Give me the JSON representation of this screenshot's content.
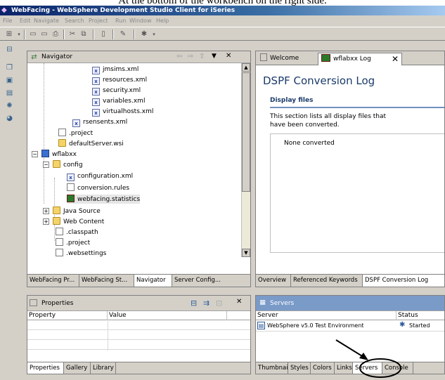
{
  "caption": "At the bottom of the workbench on the right side.",
  "window": {
    "title": "WebFacing - WebSphere Development Studio Client for iSeries"
  },
  "menu": [
    "File",
    "Edit",
    "Navigate",
    "Search",
    "Project",
    "Run",
    "Window",
    "Help"
  ],
  "navigator": {
    "title": "Navigator",
    "tree": [
      {
        "label": "jmsims.xml",
        "icon": "xml-file-icon"
      },
      {
        "label": "resources.xml",
        "icon": "xml-file-icon"
      },
      {
        "label": "security.xml",
        "icon": "xml-file-icon"
      },
      {
        "label": "variables.xml",
        "icon": "xml-file-icon"
      },
      {
        "label": "virtualhosts.xml",
        "icon": "xml-file-icon"
      },
      {
        "label": "rsensents.xml",
        "icon": "xml-file-icon"
      },
      {
        "label": ".project",
        "icon": "file-icon"
      },
      {
        "label": "defaultServer.wsi",
        "icon": "folder-icon"
      },
      {
        "label": "wflabxx",
        "icon": "project-icon"
      },
      {
        "label": "config",
        "icon": "folder-icon"
      },
      {
        "label": "configuration.xml",
        "icon": "xml-file-icon"
      },
      {
        "label": "conversion.rules",
        "icon": "file-icon"
      },
      {
        "label": "webfacing.statistics",
        "icon": "statistics-file-icon"
      },
      {
        "label": "Java Source",
        "icon": "folder-icon"
      },
      {
        "label": "Web Content",
        "icon": "folder-icon"
      },
      {
        "label": ".classpath",
        "icon": "file-icon"
      },
      {
        "label": ".project",
        "icon": "file-icon"
      },
      {
        "label": ".websettings",
        "icon": "file-icon"
      }
    ],
    "tabs": [
      "WebFacing Pr...",
      "WebFacing St...",
      "Navigator",
      "Server Config..."
    ],
    "active_tab": "Navigator"
  },
  "editor": {
    "tabs": [
      "Welcome",
      "wflabxx Log"
    ],
    "title": "DSPF Conversion Log",
    "section": "Display files",
    "description": "This section lists all display files that have been converted.",
    "empty": "None converted",
    "bottom_tabs": [
      "Overview",
      "Referenced Keywords",
      "DSPF Conversion Log"
    ]
  },
  "properties": {
    "title": "Properties",
    "columns": [
      "Property",
      "Value"
    ],
    "tabs": [
      "Properties",
      "Gallery",
      "Library"
    ]
  },
  "servers": {
    "title": "Servers",
    "columns": [
      "Server",
      "Status"
    ],
    "rows": [
      {
        "server": "WebSphere v5.0 Test Environment",
        "status": "Started"
      }
    ],
    "tabs": [
      "Thumbnail",
      "Styles",
      "Colors",
      "Links",
      "Servers",
      "Console"
    ],
    "active_tab": "Servers"
  }
}
